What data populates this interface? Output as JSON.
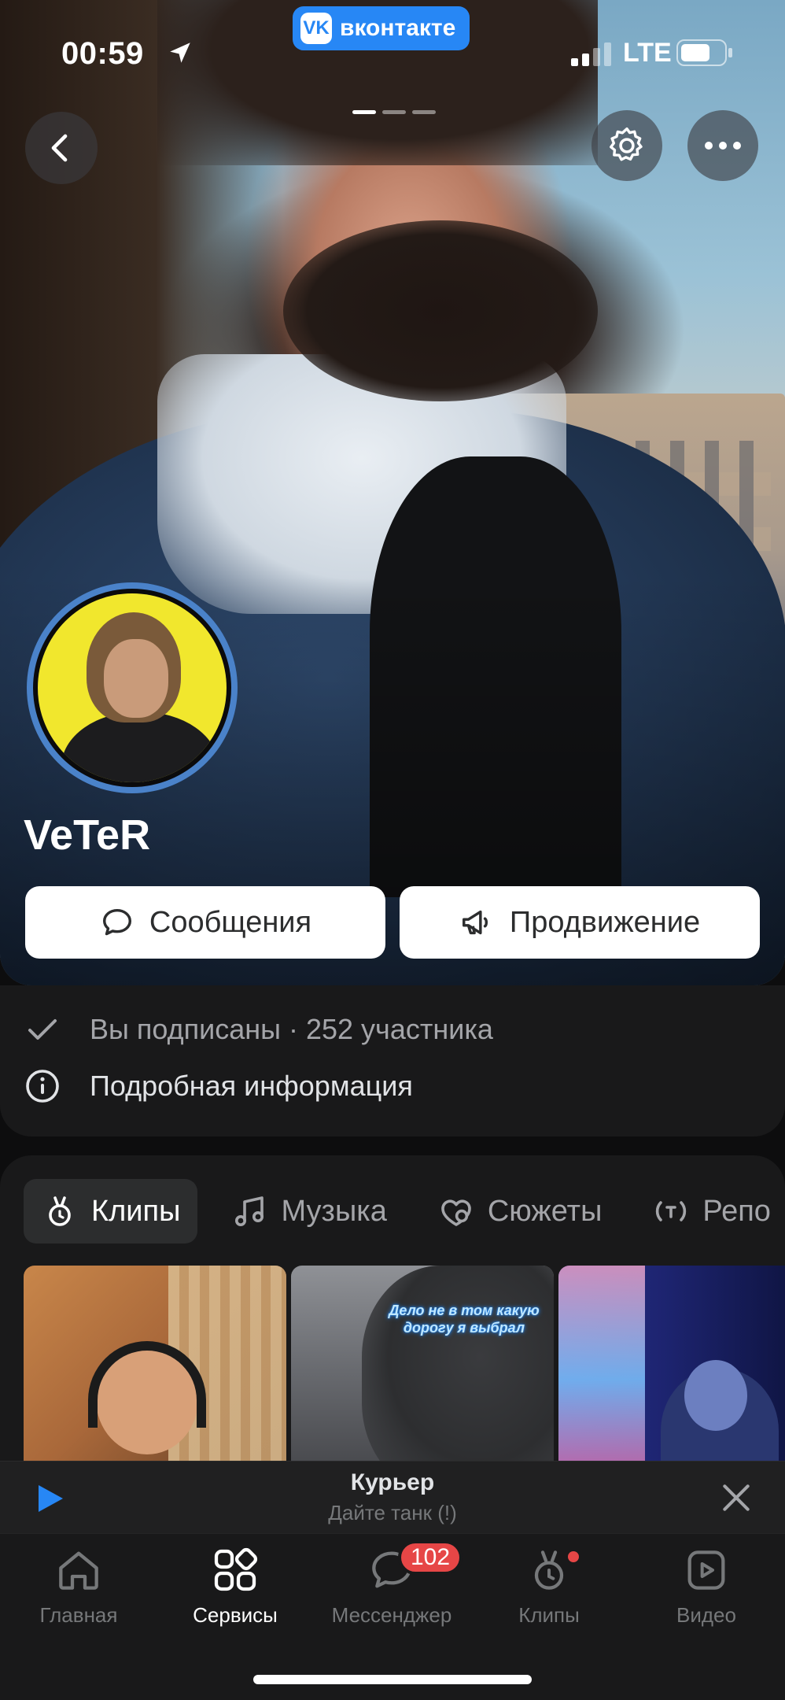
{
  "status_bar": {
    "time": "00:59",
    "network": "LTE",
    "app_pill": "вконтакте",
    "app_logo": "VK"
  },
  "group": {
    "name": "VeTeR",
    "subscription_text": "Вы подписаны · 252 участника",
    "details_text": "Подробная информация"
  },
  "actions": {
    "messages_label": "Сообщения",
    "promotion_label": "Продвижение"
  },
  "tabs": [
    {
      "label": "Клипы",
      "icon": "clips-icon",
      "active": true
    },
    {
      "label": "Музыка",
      "icon": "music-icon",
      "active": false
    },
    {
      "label": "Сюжеты",
      "icon": "stories-icon",
      "active": false
    },
    {
      "label": "Репо",
      "icon": "broadcast-icon",
      "active": false
    }
  ],
  "clips": [
    {
      "caption": ""
    },
    {
      "caption": "Дело не в том какую дорогу я выбрал"
    },
    {
      "caption": ""
    }
  ],
  "player": {
    "title": "Курьер",
    "artist": "Дайте танк (!)"
  },
  "tabbar": [
    {
      "label": "Главная",
      "icon": "home-icon",
      "active": false
    },
    {
      "label": "Сервисы",
      "icon": "services-icon",
      "active": true
    },
    {
      "label": "Мессенджер",
      "icon": "messenger-icon",
      "active": false,
      "badge": "102"
    },
    {
      "label": "Клипы",
      "icon": "clips-icon",
      "active": false,
      "dot": true
    },
    {
      "label": "Видео",
      "icon": "video-icon",
      "active": false
    }
  ],
  "colors": {
    "accent": "#2787f5",
    "badge": "#e64646",
    "background": "#0d0d0e",
    "card": "#19191a"
  }
}
